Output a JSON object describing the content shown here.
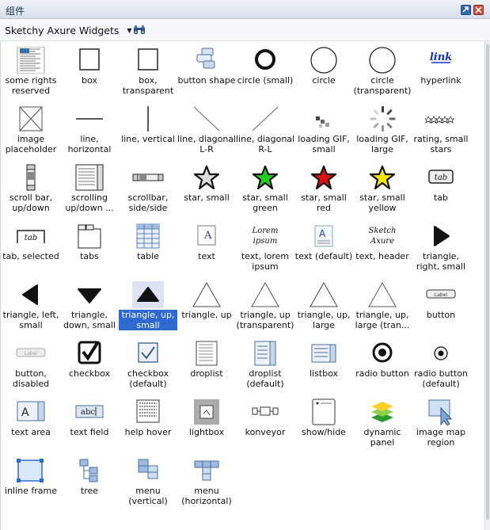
{
  "window": {
    "title": "组件"
  },
  "toolbar": {
    "library": "Sketchy Axure Widgets"
  },
  "colors": {
    "selection": "#2f6ad0",
    "star_green": "#22cc22",
    "star_red": "#dd1111",
    "star_yellow": "#f5e600"
  },
  "widgets": [
    {
      "label1": "some rights",
      "label2": "reserved",
      "icon": "cc-license-icon"
    },
    {
      "label1": "box",
      "label2": "",
      "icon": "box-icon"
    },
    {
      "label1": "box,",
      "label2": "transparent",
      "icon": "box-transparent-icon"
    },
    {
      "label1": "button shape",
      "label2": "",
      "icon": "button-shape-icon"
    },
    {
      "label1": "circle (small)",
      "label2": "",
      "icon": "circle-small-icon"
    },
    {
      "label1": "circle",
      "label2": "",
      "icon": "circle-icon"
    },
    {
      "label1": "circle",
      "label2": "(transparent)",
      "icon": "circle-transparent-icon"
    },
    {
      "label1": "hyperlink",
      "label2": "",
      "icon": "hyperlink-icon"
    },
    {
      "label1": "image",
      "label2": "placeholder",
      "icon": "image-placeholder-icon"
    },
    {
      "label1": "line,",
      "label2": "horizontal",
      "icon": "line-horizontal-icon"
    },
    {
      "label1": "line, vertical",
      "label2": "",
      "icon": "line-vertical-icon"
    },
    {
      "label1": "line, diagonal",
      "label2": "L-R",
      "icon": "line-diagonal-lr-icon"
    },
    {
      "label1": "line, diagonal",
      "label2": "R-L",
      "icon": "line-diagonal-rl-icon"
    },
    {
      "label1": "loading GIF,",
      "label2": "small",
      "icon": "loading-small-icon"
    },
    {
      "label1": "loading GIF,",
      "label2": "large",
      "icon": "loading-large-icon"
    },
    {
      "label1": "rating, small",
      "label2": "stars",
      "icon": "rating-stars-icon"
    },
    {
      "label1": "scroll bar,",
      "label2": "up/down",
      "icon": "scrollbar-updown-icon"
    },
    {
      "label1": "scrolling",
      "label2": "up/down ...",
      "icon": "scrolling-updown-icon"
    },
    {
      "label1": "scrollbar,",
      "label2": "side/side",
      "icon": "scrollbar-sideside-icon"
    },
    {
      "label1": "star, small",
      "label2": "",
      "icon": "star-small-icon"
    },
    {
      "label1": "star, small",
      "label2": "green",
      "icon": "star-green-icon"
    },
    {
      "label1": "star, small",
      "label2": "red",
      "icon": "star-red-icon"
    },
    {
      "label1": "star, small",
      "label2": "yellow",
      "icon": "star-yellow-icon"
    },
    {
      "label1": "tab",
      "label2": "",
      "icon": "tab-icon"
    },
    {
      "label1": "tab, selected",
      "label2": "",
      "icon": "tab-selected-icon"
    },
    {
      "label1": "tabs",
      "label2": "",
      "icon": "tabs-icon"
    },
    {
      "label1": "table",
      "label2": "",
      "icon": "table-icon"
    },
    {
      "label1": "text",
      "label2": "",
      "icon": "text-icon"
    },
    {
      "label1": "text, lorem",
      "label2": "ipsum",
      "icon": "lorem-ipsum-icon"
    },
    {
      "label1": "text (default)",
      "label2": "",
      "icon": "text-default-icon"
    },
    {
      "label1": "text, header",
      "label2": "",
      "icon": "text-header-icon"
    },
    {
      "label1": "triangle,",
      "label2": "right, small",
      "icon": "triangle-right-small-icon"
    },
    {
      "label1": "triangle, left,",
      "label2": "small",
      "icon": "triangle-left-small-icon"
    },
    {
      "label1": "triangle,",
      "label2": "down, small",
      "icon": "triangle-down-small-icon"
    },
    {
      "label1": "triangle, up,",
      "label2": "small",
      "icon": "triangle-up-small-icon",
      "selected": true
    },
    {
      "label1": "triangle, up",
      "label2": "",
      "icon": "triangle-up-icon"
    },
    {
      "label1": "triangle, up",
      "label2": "(transparent)",
      "icon": "triangle-up-transparent-icon"
    },
    {
      "label1": "triangle, up,",
      "label2": "large",
      "icon": "triangle-up-large-icon"
    },
    {
      "label1": "triangle, up,",
      "label2": "large (tran...",
      "icon": "triangle-up-large-transparent-icon"
    },
    {
      "label1": "button",
      "label2": "",
      "icon": "button-icon"
    },
    {
      "label1": "button,",
      "label2": "disabled",
      "icon": "button-disabled-icon"
    },
    {
      "label1": "checkbox",
      "label2": "",
      "icon": "checkbox-icon"
    },
    {
      "label1": "checkbox",
      "label2": "(default)",
      "icon": "checkbox-default-icon"
    },
    {
      "label1": "droplist",
      "label2": "",
      "icon": "droplist-icon"
    },
    {
      "label1": "droplist",
      "label2": "(default)",
      "icon": "droplist-default-icon"
    },
    {
      "label1": "listbox",
      "label2": "",
      "icon": "listbox-icon"
    },
    {
      "label1": "radio button",
      "label2": "",
      "icon": "radio-button-icon"
    },
    {
      "label1": "radio button",
      "label2": "(default)",
      "icon": "radio-button-default-icon"
    },
    {
      "label1": "text area",
      "label2": "",
      "icon": "text-area-icon"
    },
    {
      "label1": "text field",
      "label2": "",
      "icon": "text-field-icon"
    },
    {
      "label1": "help hover",
      "label2": "",
      "icon": "help-hover-icon"
    },
    {
      "label1": "lightbox",
      "label2": "",
      "icon": "lightbox-icon"
    },
    {
      "label1": "konveyor",
      "label2": "",
      "icon": "konveyor-icon"
    },
    {
      "label1": "show/hide",
      "label2": "",
      "icon": "show-hide-icon"
    },
    {
      "label1": "dynamic",
      "label2": "panel",
      "icon": "dynamic-panel-icon"
    },
    {
      "label1": "image map",
      "label2": "region",
      "icon": "image-map-region-icon"
    },
    {
      "label1": "inline frame",
      "label2": "",
      "icon": "inline-frame-icon"
    },
    {
      "label1": "tree",
      "label2": "",
      "icon": "tree-icon"
    },
    {
      "label1": "menu",
      "label2": "(vertical)",
      "icon": "menu-vertical-icon"
    },
    {
      "label1": "menu",
      "label2": "(horizontal)",
      "icon": "menu-horizontal-icon"
    }
  ],
  "icon_text": {
    "hyperlink": "link",
    "tab": "tab",
    "text": "A",
    "lorem1": "Lorem",
    "lorem2": "ipsum",
    "sketch1": "Sketch",
    "sketch2": "Axure",
    "button": "Label",
    "text_field": "abc",
    "textarea": "A"
  }
}
